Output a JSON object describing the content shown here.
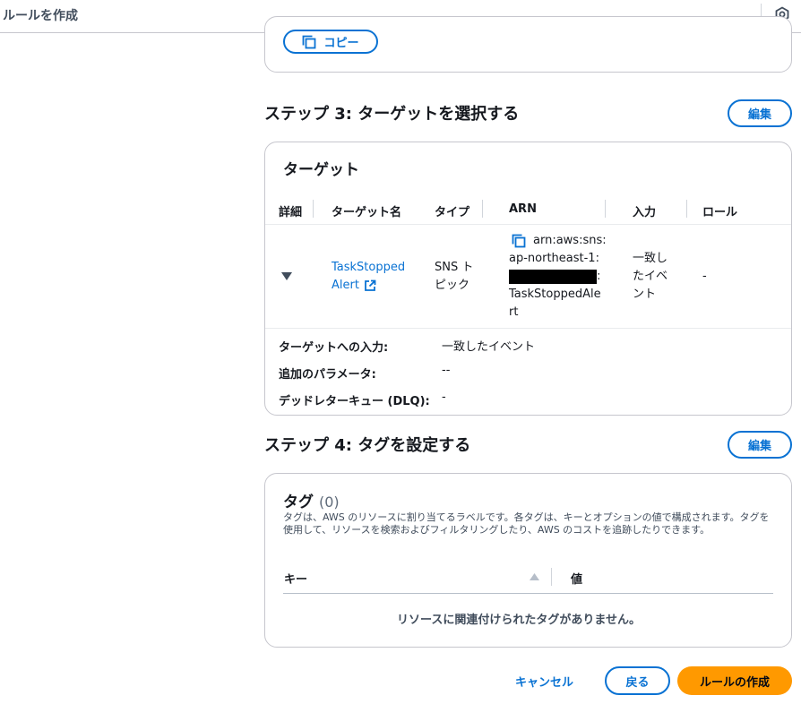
{
  "header": {
    "title": "ルールを作成",
    "icon": "settings-hex-icon"
  },
  "top_card": {
    "copy_button": "コピー",
    "copy_icon": "copy-icon"
  },
  "step3": {
    "title": "ステップ 3: ターゲットを選択する",
    "edit_button": "編集",
    "card_title": "ターゲット",
    "columns": [
      "詳細",
      "ターゲット名",
      "タイプ",
      "ARN",
      "入力",
      "ロール"
    ],
    "row": {
      "expand_icon": "caret-down-icon",
      "target_name_line1": "TaskStopped",
      "target_name_line2": "Alert",
      "external_icon": "external-link-icon",
      "type_line1": "SNS ト",
      "type_line2": "ピック",
      "arn_line1": "arn:aws:sns:",
      "arn_line2": "ap-northeast-1:",
      "arn_line3_suffix": ":",
      "arn_line4": "TaskStoppedAle",
      "arn_line5": "rt",
      "input_line1": "一致し",
      "input_line2": "たイベ",
      "input_line3": "ント",
      "role": "-"
    },
    "details": [
      {
        "label": "ターゲットへの入力:",
        "value": "一致したイベント"
      },
      {
        "label": "追加のパラメータ:",
        "value": "--"
      },
      {
        "label": "デッドレターキュー (DLQ):",
        "value": "-"
      }
    ]
  },
  "step4": {
    "title": "ステップ 4: タグを設定する",
    "edit_button": "編集",
    "card_title": "タグ",
    "tag_count": "(0)",
    "description": "タグは、AWS のリソースに割り当てるラベルです。各タグは、キーとオプションの値で構成されます。タグを使用して、リソースを検索およびフィルタリングしたり、AWS のコストを追跡したりできます。",
    "col_key": "キー",
    "col_value": "値",
    "sort_icon": "sort-up-icon",
    "empty_message": "リソースに関連付けられたタグがありません。"
  },
  "footer": {
    "cancel": "キャンセル",
    "back": "戻る",
    "create": "ルールの作成"
  },
  "colors": {
    "accent": "#0972d3",
    "primary_button": "#ff9900",
    "border": "#c6c6cd"
  }
}
